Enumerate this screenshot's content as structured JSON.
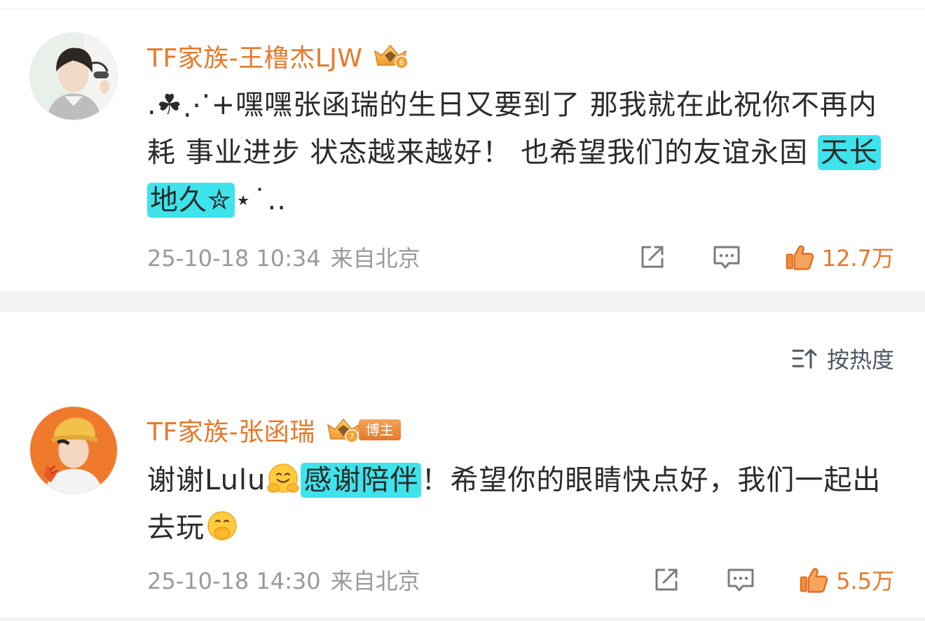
{
  "posts": [
    {
      "username": "TF家族-王橹杰LJW",
      "content": {
        "prefix": ".☘⋰+嘿嘿张函瑞的生日又要到了  那我就在此祝你不再内耗  事业进步  状态越来越好！  也希望我们的友谊永固  ",
        "highlight": "天长地久✮",
        "suffix": "⋆˙.."
      },
      "date": "25-10-18 10:34",
      "location": "来自北京",
      "likes": "12.7万",
      "badge_icon": "crown-level-badge-icon",
      "avatar_icon": "user-avatar-icon"
    },
    {
      "username": "TF家族-张函瑞",
      "badge_label": "博主",
      "content": {
        "part1": "谢谢Lulu",
        "emoji1": "hugging-face-emoji",
        "highlight": "感谢陪伴",
        "part2": "！希望你的眼睛快点好，我们一起出去玩",
        "emoji2": "face-with-hand-over-mouth-emoji"
      },
      "date": "25-10-18 14:30",
      "location": "来自北京",
      "likes": "5.5万",
      "badge_icon": "crown-level-badge-icon",
      "avatar_icon": "user-avatar-icon"
    }
  ],
  "sort": {
    "label": "按热度",
    "icon": "sort-icon"
  },
  "icons": {
    "share": "share-icon",
    "comment": "comment-icon",
    "like": "thumbs-up-icon"
  },
  "colors": {
    "username": "#e6792b",
    "like": "#e6792b",
    "highlight": "#3fe3ec",
    "meta": "#9a9a9a",
    "divider": "#f2f2f2"
  }
}
